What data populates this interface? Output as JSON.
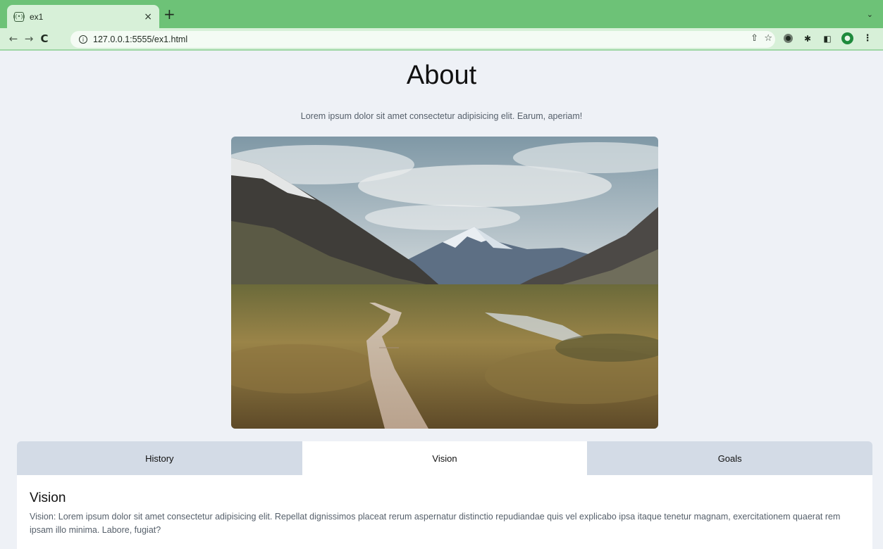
{
  "browser": {
    "tab_title": "ex1",
    "tab_favicon": "radio-icon",
    "tab_close": "×",
    "new_tab": "+",
    "tab_menu": "⌄",
    "nav_back": "←",
    "nav_forward": "→",
    "nav_reload": "C",
    "url": "127.0.0.1:5555/ex1.html"
  },
  "page": {
    "title": "About",
    "subtitle": "Lorem ipsum dolor sit amet consectetur adipisicing elit. Earum, aperiam!"
  },
  "tabs": [
    {
      "label": "History",
      "active": false
    },
    {
      "label": "Vision",
      "active": true
    },
    {
      "label": "Goals",
      "active": false
    }
  ],
  "panel": {
    "title": "Vision",
    "text": "Vision: Lorem ipsum dolor sit amet consectetur adipisicing elit. Repellat dignissimos placeat rerum aspernatur distinctio repudiandae quis vel explicabo ipsa itaque tenetur magnam, exercitationem quaerat rem ipsam illo minima. Labore, fugiat?"
  },
  "colors": {
    "chrome_green": "#6dc277",
    "page_bg": "#eef1f6",
    "tab_inactive": "#d3dbe6",
    "tab_active": "#ffffff"
  }
}
